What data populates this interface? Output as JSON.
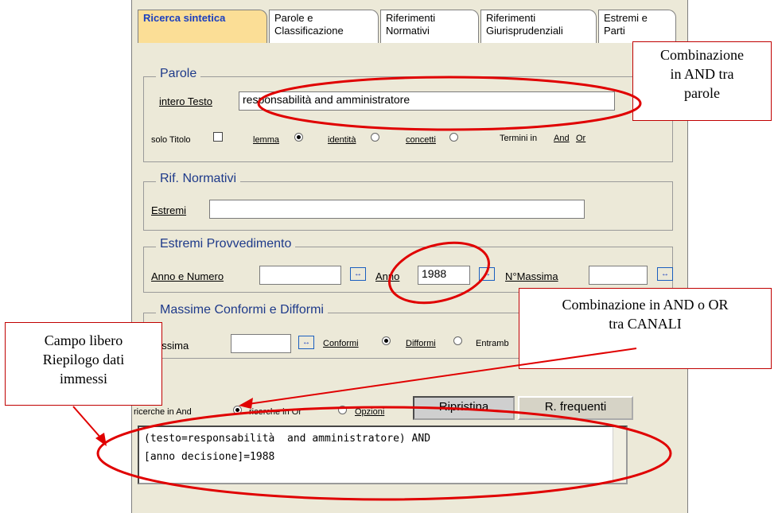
{
  "tabs": [
    {
      "label": "Ricerca sintetica"
    },
    {
      "label1": "Parole e",
      "label2": "Classificazione"
    },
    {
      "label1": "Riferimenti",
      "label2": "Normativi"
    },
    {
      "label1": "Riferimenti",
      "label2": "Giurisprudenziali"
    },
    {
      "label1": "Estremi e",
      "label2": "Parti"
    }
  ],
  "parole": {
    "legend": "Parole",
    "intero_label": "intero Testo",
    "intero_value": "responsabilità  and amministratore",
    "solo_titolo": "solo Titolo",
    "lemma": "lemma",
    "identita": "identità",
    "concetti": "concetti",
    "termini": "Termini in",
    "and": "And",
    "or": "Or"
  },
  "rif_normativi": {
    "legend": "Rif. Normativi",
    "estremi_label": "Estremi",
    "estremi_value": ""
  },
  "estremi_provv": {
    "legend": "Estremi Provvedimento",
    "anno_numero": "Anno e Numero",
    "anno_label": "Anno",
    "anno_value": "1988",
    "massima_label": "N°Massima"
  },
  "massime": {
    "legend": "Massime Conformi e Difformi",
    "massima_label": "°Massima",
    "conformi": "Conformi",
    "difformi": "Difformi",
    "entrambe": "Entramb"
  },
  "bottom": {
    "ricerche_and": "ricerche in And",
    "ricerche_or": "ricerche in Or",
    "opzioni": "Opzioni",
    "ripristina": "Ripristina",
    "frequenti": "R. frequenti"
  },
  "summary": {
    "line1": "(testo=responsabilità  and amministratore) AND",
    "line2": "[anno decisione]=1988"
  },
  "callouts": {
    "and_parole": [
      "Combinazione",
      "in AND tra",
      "parole"
    ],
    "canali": [
      "Combinazione in AND o OR",
      "tra CANALI"
    ],
    "campo": [
      "Campo libero",
      "Riepilogo dati",
      "immessi"
    ]
  },
  "colors": {
    "annotation": "#e00000",
    "active_tab": "#fbde96",
    "panel": "#ece9d8"
  }
}
